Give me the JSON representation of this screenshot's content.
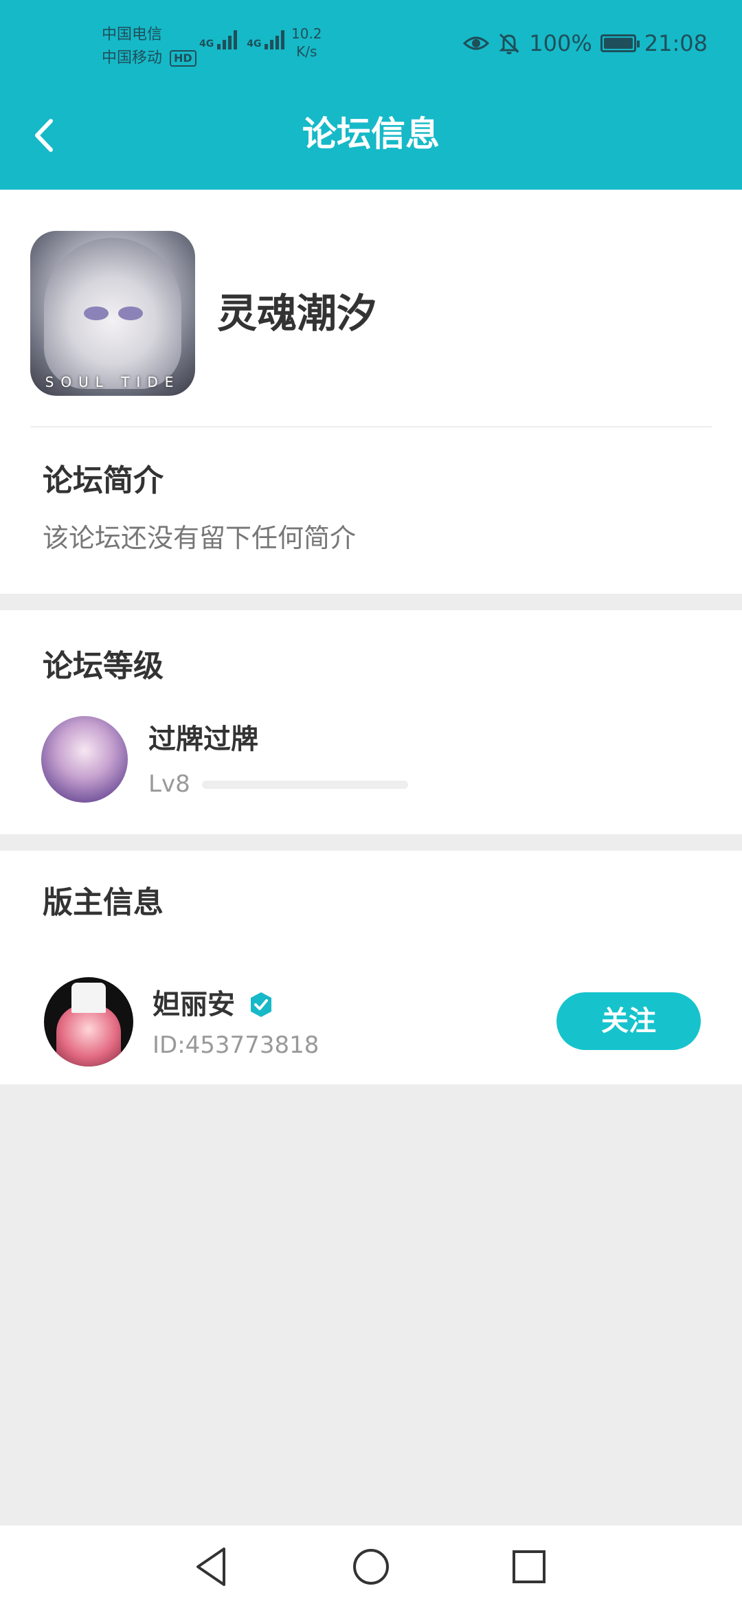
{
  "status_bar": {
    "carrier_1": "中国电信",
    "carrier_2": "中国移动",
    "hd_badge": "HD",
    "network_1": "4G",
    "network_2": "4G",
    "speed_value": "10.2",
    "speed_unit": "K/s",
    "battery_percent": "100%",
    "battery_level": 1.0,
    "time": "21:08"
  },
  "header": {
    "title": "论坛信息"
  },
  "forum": {
    "name": "灵魂潮汐",
    "avatar_brand_text": "SOUL TIDE"
  },
  "intro": {
    "title": "论坛简介",
    "text": "该论坛还没有留下任何简介"
  },
  "level": {
    "title": "论坛等级",
    "name": "过牌过牌",
    "lv": "Lv8",
    "progress": 0.0
  },
  "moderator": {
    "section_title": "版主信息",
    "name": "妲丽安",
    "id": "ID:453773818",
    "follow_label": "关注"
  },
  "colors": {
    "accent": "#16b9c8",
    "follow_button": "#16c3cc",
    "background": "#ededed"
  },
  "icons": {
    "back": "chevron-left-icon",
    "eye": "eye-icon",
    "bell_off": "bell-off-icon",
    "verify": "verified-badge-icon",
    "nav_back": "triangle-back-icon",
    "nav_home": "circle-home-icon",
    "nav_recent": "square-recent-icon"
  }
}
